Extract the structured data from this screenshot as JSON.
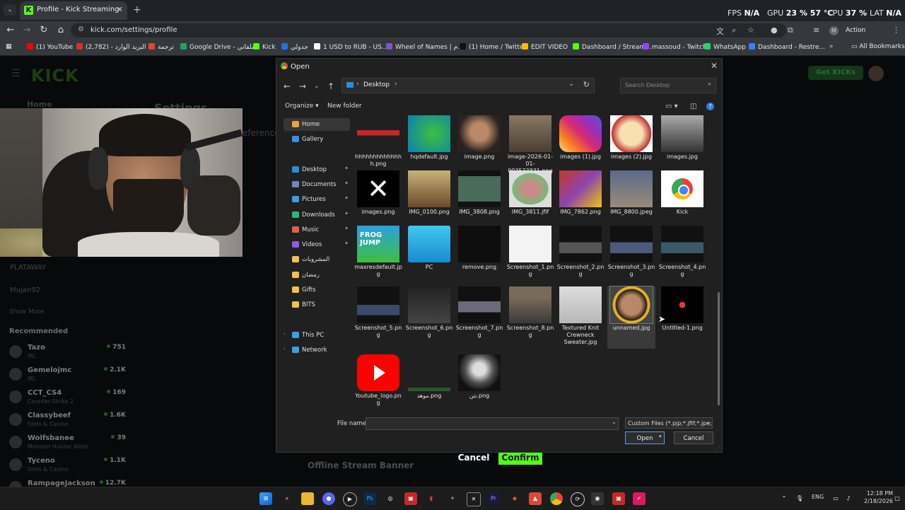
{
  "browser": {
    "tab_title": "Profile - Kick Streaming",
    "tab_favicon": "K",
    "url": "kick.com/settings/profile",
    "action_required": "Action required",
    "profile_letter": "M",
    "stats": {
      "fps_label": "FPS",
      "fps_value": "N/A",
      "gpu_label": "GPU",
      "gpu_value": "23 % 57 °C",
      "cpu_label": "CPU",
      "cpu_value": "37 %",
      "lat_label": "LAT",
      "lat_value": "N/A"
    },
    "bookmarks": [
      {
        "label": "(1) YouTube",
        "color": "#ff0000"
      },
      {
        "label": "البريد الوارد - (2,782)",
        "color": "#d93025"
      },
      {
        "label": "ترجمة",
        "color": "#e94235"
      },
      {
        "label": "Google Drive - ملفاتي",
        "color": "#1fa463"
      },
      {
        "label": "Kick",
        "color": "#53fc18"
      },
      {
        "label": "جدولي",
        "color": "#1a73e8"
      },
      {
        "label": "1 USD to RUB - US...",
        "color": "#ffffff"
      },
      {
        "label": "Wheel of Names | م...",
        "color": "#7e57c2"
      },
      {
        "label": "(1) Home / Twitter",
        "color": "#111111"
      },
      {
        "label": "EDIT VIDEO",
        "color": "#fbbc05"
      },
      {
        "label": "Dashboard / Stream...",
        "color": "#53fc18"
      },
      {
        "label": "massoud - Twitch",
        "color": "#9146ff"
      },
      {
        "label": "WhatsApp",
        "color": "#25d366"
      },
      {
        "label": "Dashboard - Restre...",
        "color": "#3a7bff"
      }
    ],
    "all_bookmarks": "All Bookmarks"
  },
  "kick_page": {
    "logo": "KICK",
    "get_kicks": "Get KICKs",
    "home": "Home",
    "settings_title": "Settings",
    "preferences_fragment": "eference",
    "side_dim_items": [
      "PLATAWAY",
      "Mujan92"
    ],
    "show_more": "Show More",
    "recommended_title": "Recommended",
    "recommended": [
      {
        "name": "Tazo",
        "category": "IRL",
        "viewers": "751"
      },
      {
        "name": "Gemelojmc",
        "category": "IRL",
        "viewers": "2.1K"
      },
      {
        "name": "CCT_CS4",
        "category": "Counter-Strike 2",
        "viewers": "169"
      },
      {
        "name": "Classybeef",
        "category": "Slots & Casino",
        "viewers": "1.6K"
      },
      {
        "name": "Wolfsbanee",
        "category": "Monster Hunter Wilds",
        "viewers": "39"
      },
      {
        "name": "Tyceno",
        "category": "Slots & Casino",
        "viewers": "1.1K"
      },
      {
        "name": "RampageJackson",
        "category": "",
        "viewers": "12.7K"
      }
    ],
    "offline_banner": "Offline Stream Banner",
    "cancel": "Cancel",
    "confirm": "Confirm"
  },
  "dialog": {
    "title": "Open",
    "path": "Desktop",
    "search_placeholder": "Search Desktop",
    "organize": "Organize ▾",
    "new_folder": "New folder",
    "nav": [
      {
        "label": "Home",
        "icon": "home-icon",
        "color": "#e8a33d",
        "pinned": false,
        "selected": true
      },
      {
        "label": "Gallery",
        "icon": "gallery-icon",
        "color": "#3a8ee6",
        "pinned": false
      },
      {
        "label": "Desktop",
        "icon": "desktop-icon",
        "color": "#2a8be0",
        "pinned": true
      },
      {
        "label": "Documents",
        "icon": "documents-icon",
        "color": "#6d8ab3",
        "pinned": true
      },
      {
        "label": "Pictures",
        "icon": "pictures-icon",
        "color": "#3a9ee6",
        "pinned": true
      },
      {
        "label": "Downloads",
        "icon": "downloads-icon",
        "color": "#2eb67d",
        "pinned": true
      },
      {
        "label": "Music",
        "icon": "music-icon",
        "color": "#e55b4d",
        "pinned": true
      },
      {
        "label": "Videos",
        "icon": "videos-icon",
        "color": "#8e5ae8",
        "pinned": true
      },
      {
        "label": "المشروبات",
        "icon": "folder-icon",
        "color": "#f0c24a",
        "pinned": false
      },
      {
        "label": "رمضان",
        "icon": "folder-icon",
        "color": "#f0c24a",
        "pinned": false
      },
      {
        "label": "Gifts",
        "icon": "folder-icon",
        "color": "#f0c24a",
        "pinned": false
      },
      {
        "label": "BITS",
        "icon": "folder-icon",
        "color": "#f0c24a",
        "pinned": false
      },
      {
        "label": "This PC",
        "icon": "pc-icon",
        "color": "#3aa0e6",
        "pinned": false
      },
      {
        "label": "Network",
        "icon": "network-icon",
        "color": "#3aa0e6",
        "pinned": false
      }
    ],
    "files": [
      {
        "name": "hhhhhhhhhhhhhh.png",
        "thumb": "banner"
      },
      {
        "name": "hqdefault.jpg",
        "thumb": "green"
      },
      {
        "name": "image.png",
        "thumb": "face"
      },
      {
        "name": "image-2026-01-01-003533831.png",
        "thumb": "people"
      },
      {
        "name": "images (1).jpg",
        "thumb": "instagram"
      },
      {
        "name": "images (2).jpg",
        "thumb": "cartoon"
      },
      {
        "name": "images.jpg",
        "thumb": "bw"
      },
      {
        "name": "images.png",
        "thumb": "x"
      },
      {
        "name": "IMG_0100.png",
        "thumb": "kid"
      },
      {
        "name": "IMG_3808.png",
        "thumb": "phone"
      },
      {
        "name": "IMG_3811.jfif",
        "thumb": "photo"
      },
      {
        "name": "IMG_7862.png",
        "thumb": "colorful"
      },
      {
        "name": "IMG_8800.jpeg",
        "thumb": "people2"
      },
      {
        "name": "Kick",
        "thumb": "chrome"
      },
      {
        "name": "maxresdefault.jpg",
        "thumb": "frog"
      },
      {
        "name": "PC",
        "thumb": "monitor"
      },
      {
        "name": "remove.png",
        "thumb": "dark"
      },
      {
        "name": "Screenshot_1.png",
        "thumb": "white"
      },
      {
        "name": "Screenshot_2.png",
        "thumb": "strip"
      },
      {
        "name": "Screenshot_3.png",
        "thumb": "strip2"
      },
      {
        "name": "Screenshot_4.png",
        "thumb": "strip3"
      },
      {
        "name": "Screenshot_5.png",
        "thumb": "strip4"
      },
      {
        "name": "Screenshot_6.png",
        "thumb": "darkui"
      },
      {
        "name": "Screenshot_7.png",
        "thumb": "strip5"
      },
      {
        "name": "Screenshot_8.png",
        "thumb": "people3"
      },
      {
        "name": "Textured Knit Crewneck Sweater.jpg",
        "thumb": "sweater"
      },
      {
        "name": "unnamed.jpg",
        "thumb": "avatar",
        "selected": true
      },
      {
        "name": "Untitled-1.png",
        "thumb": "yt-small"
      },
      {
        "name": "Youtube_logo.png",
        "thumb": "youtube"
      },
      {
        "name": "موهد.png",
        "thumb": "thinline"
      },
      {
        "name": "نتن.png",
        "thumb": "robot"
      }
    ],
    "file_name_label": "File name:",
    "file_name_value": "",
    "file_type": "Custom Files (*.pjp;*.jfif;*.jpe;*.",
    "open_button": "Open",
    "cancel_button": "Cancel"
  },
  "taskbar": {
    "lang": "ENG",
    "time": "12:18 PM",
    "date": "2/18/2026"
  }
}
